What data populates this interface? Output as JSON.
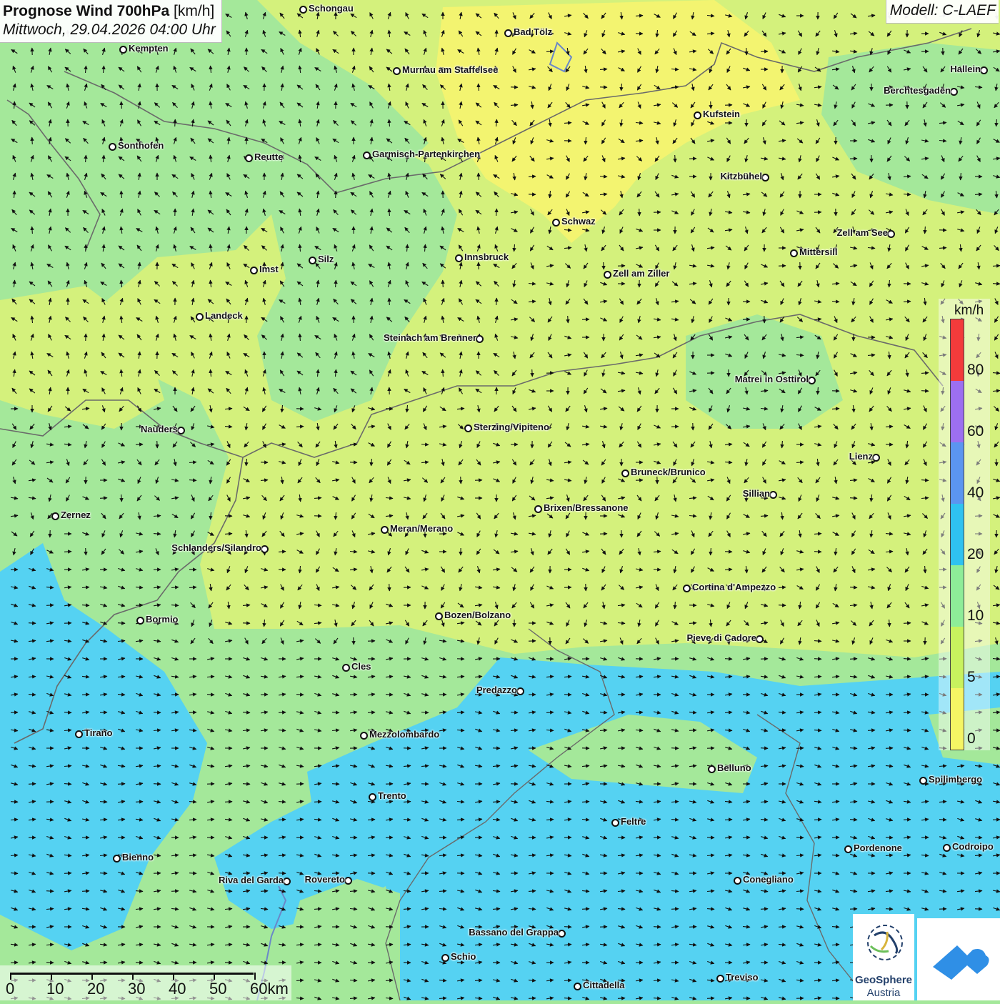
{
  "header": {
    "title_bold": "Prognose Wind 700hPa",
    "title_unit": "[km/h]",
    "datetime": "Mittwoch, 29.04.2026 04:00 Uhr",
    "model": "Modell: C-LAEF"
  },
  "cities": [
    {
      "name": "Schongau"
    },
    {
      "name": "Bad Tölz"
    },
    {
      "name": "Kempten"
    },
    {
      "name": "Murnau am Staffelsee"
    },
    {
      "name": "Hallein"
    },
    {
      "name": "Berchtesgaden"
    },
    {
      "name": "Kufstein"
    },
    {
      "name": "Sonthofen"
    },
    {
      "name": "Reutte"
    },
    {
      "name": "Garmisch-Partenkirchen"
    },
    {
      "name": "Kitzbühel"
    },
    {
      "name": "Schwaz"
    },
    {
      "name": "Zell am See"
    },
    {
      "name": "Mittersill"
    },
    {
      "name": "Innsbruck"
    },
    {
      "name": "Silz"
    },
    {
      "name": "Imst"
    },
    {
      "name": "Zell am Ziller"
    },
    {
      "name": "Landeck"
    },
    {
      "name": "Steinach am Brenner"
    },
    {
      "name": "Matrei in Osttirol"
    },
    {
      "name": "Nauders"
    },
    {
      "name": "Sterzing/Vipiteno"
    },
    {
      "name": "Lienz"
    },
    {
      "name": "Bruneck/Brunico"
    },
    {
      "name": "Sillian"
    },
    {
      "name": "Brixen/Bressanone"
    },
    {
      "name": "Zernez"
    },
    {
      "name": "Meran/Merano"
    },
    {
      "name": "Schlanders/Silandro"
    },
    {
      "name": "Cortina d'Ampezzo"
    },
    {
      "name": "Bozen/Bolzano"
    },
    {
      "name": "Bormio"
    },
    {
      "name": "Pieve di Cadore"
    },
    {
      "name": "Cles"
    },
    {
      "name": "Predazzo"
    },
    {
      "name": "Tirano"
    },
    {
      "name": "Mezzolombardo"
    },
    {
      "name": "Belluno"
    },
    {
      "name": "Spilimbergo"
    },
    {
      "name": "Trento"
    },
    {
      "name": "Feltre"
    },
    {
      "name": "Pordenone"
    },
    {
      "name": "Codroipo"
    },
    {
      "name": "Bienno"
    },
    {
      "name": "Riva del Garda"
    },
    {
      "name": "Rovereto"
    },
    {
      "name": "Conegliano"
    },
    {
      "name": "Bassano del Grappa"
    },
    {
      "name": "Schio"
    },
    {
      "name": "Treviso"
    },
    {
      "name": "Cittadella"
    }
  ],
  "legend": {
    "unit": "km/h",
    "ticks": [
      "80",
      "60",
      "40",
      "20",
      "10",
      "5",
      "0"
    ],
    "colors": [
      "#f23b3b",
      "#9c6ff0",
      "#5b95f0",
      "#2fc2f0",
      "#8eed98",
      "#c8f25e",
      "#f5f564"
    ]
  },
  "scale_bar": {
    "labels": [
      "0",
      "10",
      "20",
      "30",
      "40",
      "50",
      "60km"
    ]
  },
  "logos": {
    "geosphere_line1": "GeoSphere",
    "geosphere_line2": "Austria"
  },
  "colors": {
    "calm_yellow": "#f4f470",
    "light_yellow": "#d7f27a",
    "green": "#a4e89a",
    "cyan": "#55d2f2",
    "brand_blue": "#2f8fe6"
  }
}
